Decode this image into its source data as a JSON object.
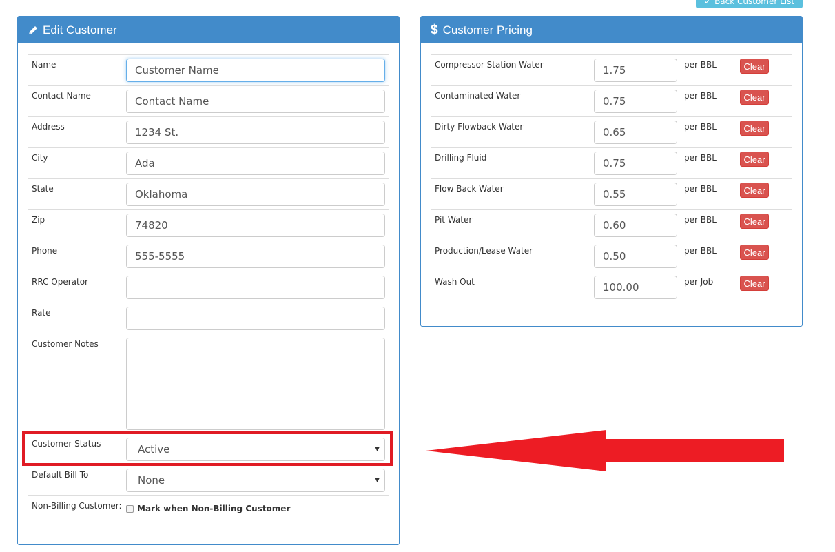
{
  "top_button": {
    "label": "Back Customer List",
    "icon": "check-icon"
  },
  "edit_panel": {
    "title": "Edit Customer",
    "icon": "pencil-icon",
    "fields": [
      {
        "label": "Name",
        "value": "Customer Name"
      },
      {
        "label": "Contact Name",
        "value": "Contact Name"
      },
      {
        "label": "Address",
        "value": "1234 St."
      },
      {
        "label": "City",
        "value": "Ada"
      },
      {
        "label": "State",
        "value": "Oklahoma"
      },
      {
        "label": "Zip",
        "value": "74820"
      },
      {
        "label": "Phone",
        "value": "555-5555"
      },
      {
        "label": "RRC Operator",
        "value": ""
      },
      {
        "label": "Rate",
        "value": ""
      }
    ],
    "notes": {
      "label": "Customer Notes",
      "value": ""
    },
    "status": {
      "label": "Customer Status",
      "selected": "Active"
    },
    "default_bill_to": {
      "label": "Default Bill To",
      "selected": "None"
    },
    "non_billing": {
      "label": "Non-Billing Customer:",
      "checkbox_label": "Mark when Non-Billing Customer",
      "checked": false
    }
  },
  "pricing_panel": {
    "title": "Customer Pricing",
    "icon": "dollar-icon",
    "clear_label": "Clear",
    "items": [
      {
        "label": "Compressor Station Water",
        "value": "1.75",
        "unit": "per BBL"
      },
      {
        "label": "Contaminated Water",
        "value": "0.75",
        "unit": "per BBL"
      },
      {
        "label": "Dirty Flowback Water",
        "value": "0.65",
        "unit": "per BBL"
      },
      {
        "label": "Drilling Fluid",
        "value": "0.75",
        "unit": "per BBL"
      },
      {
        "label": "Flow Back Water",
        "value": "0.55",
        "unit": "per BBL"
      },
      {
        "label": "Pit Water",
        "value": "0.60",
        "unit": "per BBL"
      },
      {
        "label": "Production/Lease Water",
        "value": "0.50",
        "unit": "per BBL"
      },
      {
        "label": "Wash Out",
        "value": "100.00",
        "unit": "per Job"
      }
    ]
  },
  "colors": {
    "primary": "#428bca",
    "info": "#5bc0de",
    "danger": "#d9534f",
    "annotation": "#e01b24"
  }
}
